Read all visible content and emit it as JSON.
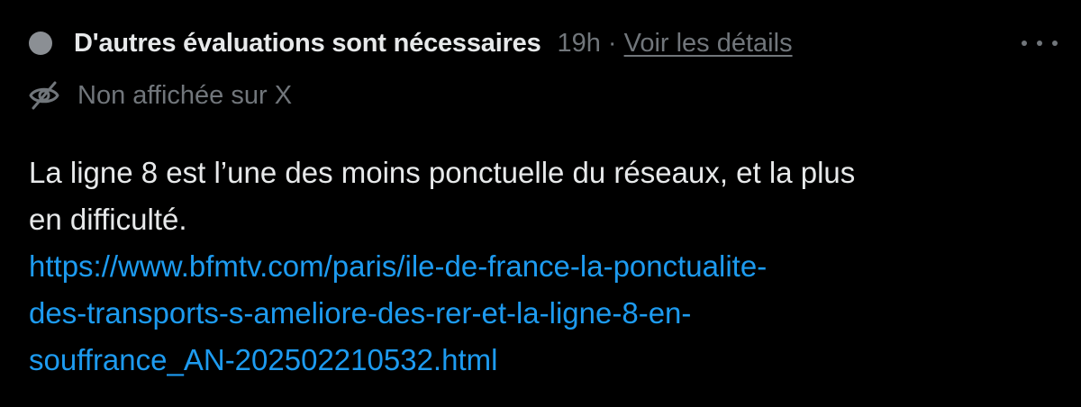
{
  "note": {
    "status_title": "D'autres évaluations sont nécessaires",
    "timestamp": "19h",
    "separator": "·",
    "details_link": "Voir les détails",
    "more_menu_icon": "more-horizontal-icon",
    "visibility_icon": "eye-slash-icon",
    "visibility_text": "Non affichée sur X",
    "body": {
      "line_1": "La ligne 8 est l’une des moins ponctuelle du réseaux, et la plus",
      "line_2": "en difficulté.",
      "url_lines": [
        "https://www.bfmtv.com/paris/ile-de-france-la-ponctualite-",
        "des-transports-s-ameliore-des-rer-et-la-ligne-8-en-",
        "souffrance_AN-202502210532.html"
      ]
    }
  },
  "colors": {
    "background": "#000000",
    "primary_text": "#e7e9ea",
    "secondary_text": "#71767b",
    "status_dot": "#8b8f94",
    "link": "#1d9bf0"
  }
}
